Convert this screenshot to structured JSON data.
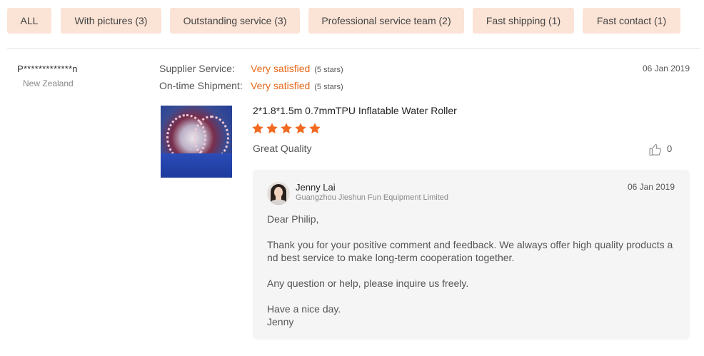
{
  "filters": [
    {
      "label": "ALL"
    },
    {
      "label": "With pictures (3)"
    },
    {
      "label": "Outstanding service (3)"
    },
    {
      "label": "Professional service team (2)"
    },
    {
      "label": "Fast shipping (1)"
    },
    {
      "label": "Fast contact (1)"
    }
  ],
  "review": {
    "user_name": "P*************n",
    "country": "New Zealand",
    "date": "06 Jan 2019",
    "ratings": [
      {
        "label": "Supplier Service:",
        "value": "Very satisfied",
        "stars_text": "(5 stars)"
      },
      {
        "label": "On-time Shipment:",
        "value": "Very satisfied",
        "stars_text": "(5 stars)"
      }
    ],
    "product_title": "2*1.8*1.5m 0.7mmTPU Inflatable Water Roller",
    "star_rating": 5,
    "star_color": "#f26a21",
    "text": "Great Quality",
    "likes": "0"
  },
  "reply": {
    "name": "Jenny Lai",
    "company": "Guangzhou Jieshun Fun Equipment Limited",
    "date": "06 Jan 2019",
    "greeting": "Dear Philip,",
    "body": "Thank you for your positive comment and feedback. We always offer high quality products and best service to make long-term cooperation together.",
    "closing_question": "Any question or help, please inquire us freely.",
    "signoff": "Have a nice day.",
    "signature": "Jenny"
  },
  "colors": {
    "accent": "#e8691a",
    "chip_bg": "#fbe3d5",
    "reply_bg": "#f5f5f6"
  }
}
